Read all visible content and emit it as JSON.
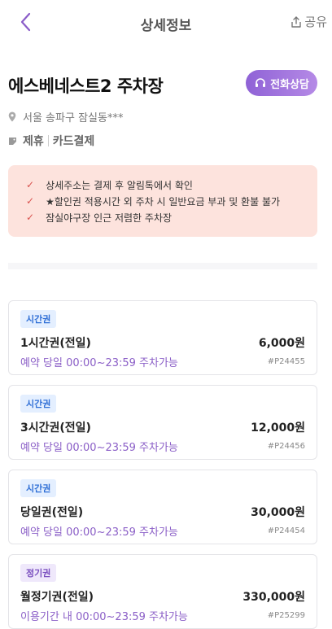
{
  "header": {
    "title": "상세정보",
    "share_label": "공유"
  },
  "place": {
    "name": "에스베네스트2 주차장",
    "call_label": "전화상담",
    "address": "서울 송파구 잠실동***",
    "tags": [
      "제휴",
      "카드결제"
    ]
  },
  "notices": [
    "상세주소는 결제 후 알림톡에서 확인",
    "★할인권 적용시간 외 주차 시 일반요금 부과 및 환불 불가",
    "잠실야구장 인근 저렴한 주차장"
  ],
  "products": [
    {
      "badge": "시간권",
      "badge_type": "time",
      "name": "1시간권(전일)",
      "price": "6,000원",
      "desc": "예약 당일 00:00~23:59 주차가능",
      "code": "#P24455"
    },
    {
      "badge": "시간권",
      "badge_type": "time",
      "name": "3시간권(전일)",
      "price": "12,000원",
      "desc": "예약 당일 00:00~23:59 주차가능",
      "code": "#P24456"
    },
    {
      "badge": "시간권",
      "badge_type": "time",
      "name": "당일권(전일)",
      "price": "30,000원",
      "desc": "예약 당일 00:00~23:59 주차가능",
      "code": "#P24454"
    },
    {
      "badge": "정기권",
      "badge_type": "season",
      "name": "월정기권(전일)",
      "price": "330,000원",
      "desc": "이용기간 내 00:00~23:59 주차가능",
      "code": "#P25299"
    }
  ]
}
